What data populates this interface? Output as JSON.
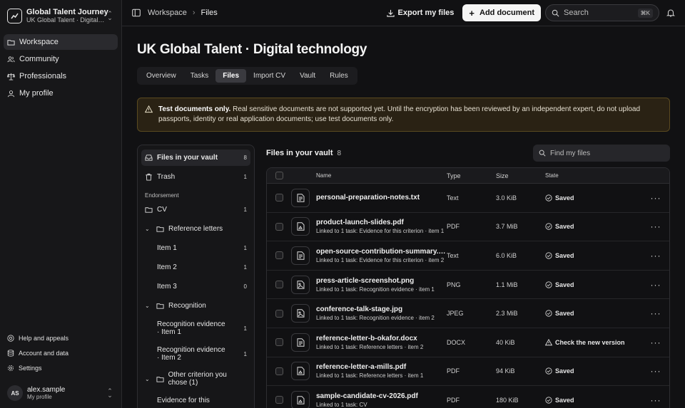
{
  "sidebar": {
    "brand_title": "Global Talent Journey",
    "brand_subtitle": "UK Global Talent · Digital t...",
    "nav": [
      {
        "label": "Workspace",
        "icon": "folder-icon"
      },
      {
        "label": "Community",
        "icon": "users-icon"
      },
      {
        "label": "Professionals",
        "icon": "scale-icon"
      },
      {
        "label": "My profile",
        "icon": "user-icon"
      }
    ],
    "footer": [
      {
        "label": "Help and appeals",
        "icon": "help-icon"
      },
      {
        "label": "Account and data",
        "icon": "database-icon"
      },
      {
        "label": "Settings",
        "icon": "gear-icon"
      }
    ],
    "user": {
      "initials": "AS",
      "name": "alex.sample",
      "sub": "My profile"
    }
  },
  "topbar": {
    "crumbs": [
      "Workspace",
      "Files"
    ],
    "export_label": "Export my files",
    "add_label": "Add document",
    "search_placeholder": "Search",
    "search_kbd": "⌘K"
  },
  "page": {
    "title": "UK Global Talent · Digital technology",
    "tabs": [
      "Overview",
      "Tasks",
      "Files",
      "Import CV",
      "Vault",
      "Rules"
    ],
    "active_tab": "Files",
    "alert_bold": "Test documents only.",
    "alert_text": " Real sensitive documents are not supported yet. Until the encryption has been reviewed by an independent expert, do not upload passports, identity or real application documents; use test documents only."
  },
  "tree": {
    "top": [
      {
        "label": "Files in your vault",
        "count": "8"
      },
      {
        "label": "Trash",
        "count": "1"
      }
    ],
    "section_label": "Endorsement",
    "cv": {
      "label": "CV",
      "count": "1"
    },
    "reference_letters": {
      "label": "Reference letters",
      "items": [
        {
          "label": "Item 1",
          "count": "1"
        },
        {
          "label": "Item 2",
          "count": "1"
        },
        {
          "label": "Item 3",
          "count": "0"
        }
      ]
    },
    "recognition": {
      "label": "Recognition",
      "items": [
        {
          "label": "Recognition evidence · Item 1",
          "count": "1"
        },
        {
          "label": "Recognition evidence · Item 2",
          "count": "1"
        }
      ]
    },
    "other": {
      "label": "Other criterion you chose (1)"
    },
    "evidence_partial": "Evidence for this"
  },
  "files": {
    "title": "Files in your vault",
    "count": "8",
    "find_placeholder": "Find my files",
    "headers": {
      "name": "Name",
      "type": "Type",
      "size": "Size",
      "state": "State"
    },
    "rows": [
      {
        "name": "personal-preparation-notes.txt",
        "sub": "",
        "type": "Text",
        "size": "3.0 KiB",
        "state": "Saved",
        "warn": false
      },
      {
        "name": "product-launch-slides.pdf",
        "sub": "Linked to 1 task: Evidence for this criterion · item 1",
        "type": "PDF",
        "size": "3.7 MiB",
        "state": "Saved",
        "warn": false
      },
      {
        "name": "open-source-contribution-summary.txt",
        "sub": "Linked to 1 task: Evidence for this criterion · item 2",
        "type": "Text",
        "size": "6.0 KiB",
        "state": "Saved",
        "warn": false
      },
      {
        "name": "press-article-screenshot.png",
        "sub": "Linked to 1 task: Recognition evidence · item 1",
        "type": "PNG",
        "size": "1.1 MiB",
        "state": "Saved",
        "warn": false
      },
      {
        "name": "conference-talk-stage.jpg",
        "sub": "Linked to 1 task: Recognition evidence · item 2",
        "type": "JPEG",
        "size": "2.3 MiB",
        "state": "Saved",
        "warn": false
      },
      {
        "name": "reference-letter-b-okafor.docx",
        "sub": "Linked to 1 task: Reference letters · item 2",
        "type": "DOCX",
        "size": "40 KiB",
        "state": "Check the new version",
        "warn": true
      },
      {
        "name": "reference-letter-a-mills.pdf",
        "sub": "Linked to 1 task: Reference letters · item 1",
        "type": "PDF",
        "size": "94 KiB",
        "state": "Saved",
        "warn": false
      },
      {
        "name": "sample-candidate-cv-2026.pdf",
        "sub": "Linked to 1 task: CV",
        "type": "PDF",
        "size": "180 KiB",
        "state": "Saved",
        "warn": false
      }
    ]
  }
}
